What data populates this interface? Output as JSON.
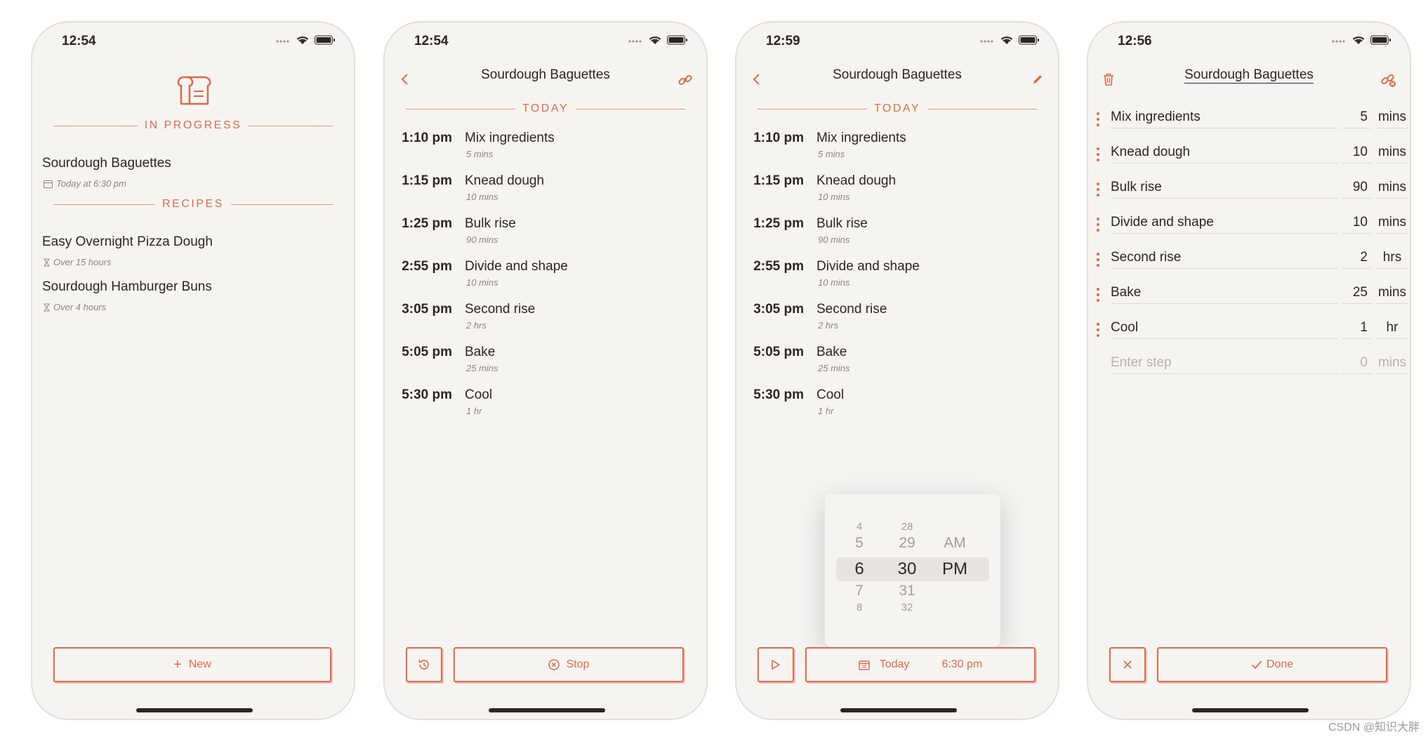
{
  "colors": {
    "accent": "#d96b4a",
    "background": "#f6f4f1",
    "text": "#2b2622",
    "muted": "#8c8580"
  },
  "screen1": {
    "time": "12:54",
    "in_progress_label": "IN PROGRESS",
    "in_progress": {
      "title": "Sourdough Baguettes",
      "subtitle": "Today at 6:30 pm",
      "icon": "calendar-icon"
    },
    "recipes_label": "RECIPES",
    "recipes": [
      {
        "title": "Easy Overnight Pizza Dough",
        "subtitle": "Over 15 hours",
        "icon": "hourglass-icon"
      },
      {
        "title": "Sourdough Hamburger Buns",
        "subtitle": "Over 4 hours",
        "icon": "hourglass-icon"
      }
    ],
    "new_button": "New"
  },
  "screen2": {
    "time": "12:54",
    "title": "Sourdough Baguettes",
    "section_label": "TODAY",
    "schedule": [
      {
        "time": "1:10 pm",
        "step": "Mix ingredients",
        "duration": "5 mins"
      },
      {
        "time": "1:15 pm",
        "step": "Knead dough",
        "duration": "10 mins"
      },
      {
        "time": "1:25 pm",
        "step": "Bulk rise",
        "duration": "90 mins"
      },
      {
        "time": "2:55 pm",
        "step": "Divide and shape",
        "duration": "10 mins"
      },
      {
        "time": "3:05 pm",
        "step": "Second rise",
        "duration": "2 hrs"
      },
      {
        "time": "5:05 pm",
        "step": "Bake",
        "duration": "25 mins"
      },
      {
        "time": "5:30 pm",
        "step": "Cool",
        "duration": "1 hr"
      }
    ],
    "stop_button": "Stop"
  },
  "screen3": {
    "time": "12:59",
    "title": "Sourdough Baguettes",
    "section_label": "TODAY",
    "picker": {
      "hours": [
        "4",
        "5",
        "6",
        "7",
        "8"
      ],
      "minutes": [
        "28",
        "29",
        "30",
        "31",
        "32"
      ],
      "periods": [
        "AM",
        "PM"
      ]
    },
    "date_button": {
      "day": "Today",
      "time": "6:30 pm"
    }
  },
  "screen4": {
    "time": "12:56",
    "title": "Sourdough Baguettes",
    "steps": [
      {
        "name": "Mix ingredients",
        "amount": "5",
        "unit": "mins"
      },
      {
        "name": "Knead dough",
        "amount": "10",
        "unit": "mins"
      },
      {
        "name": "Bulk rise",
        "amount": "90",
        "unit": "mins"
      },
      {
        "name": "Divide and shape",
        "amount": "10",
        "unit": "mins"
      },
      {
        "name": "Second rise",
        "amount": "2",
        "unit": "hrs"
      },
      {
        "name": "Bake",
        "amount": "25",
        "unit": "mins"
      },
      {
        "name": "Cool",
        "amount": "1",
        "unit": "hr"
      }
    ],
    "new_step": {
      "placeholder": "Enter step",
      "amount_placeholder": "0",
      "unit": "mins"
    },
    "done_button": "Done"
  },
  "watermark": "CSDN @知识大胖"
}
